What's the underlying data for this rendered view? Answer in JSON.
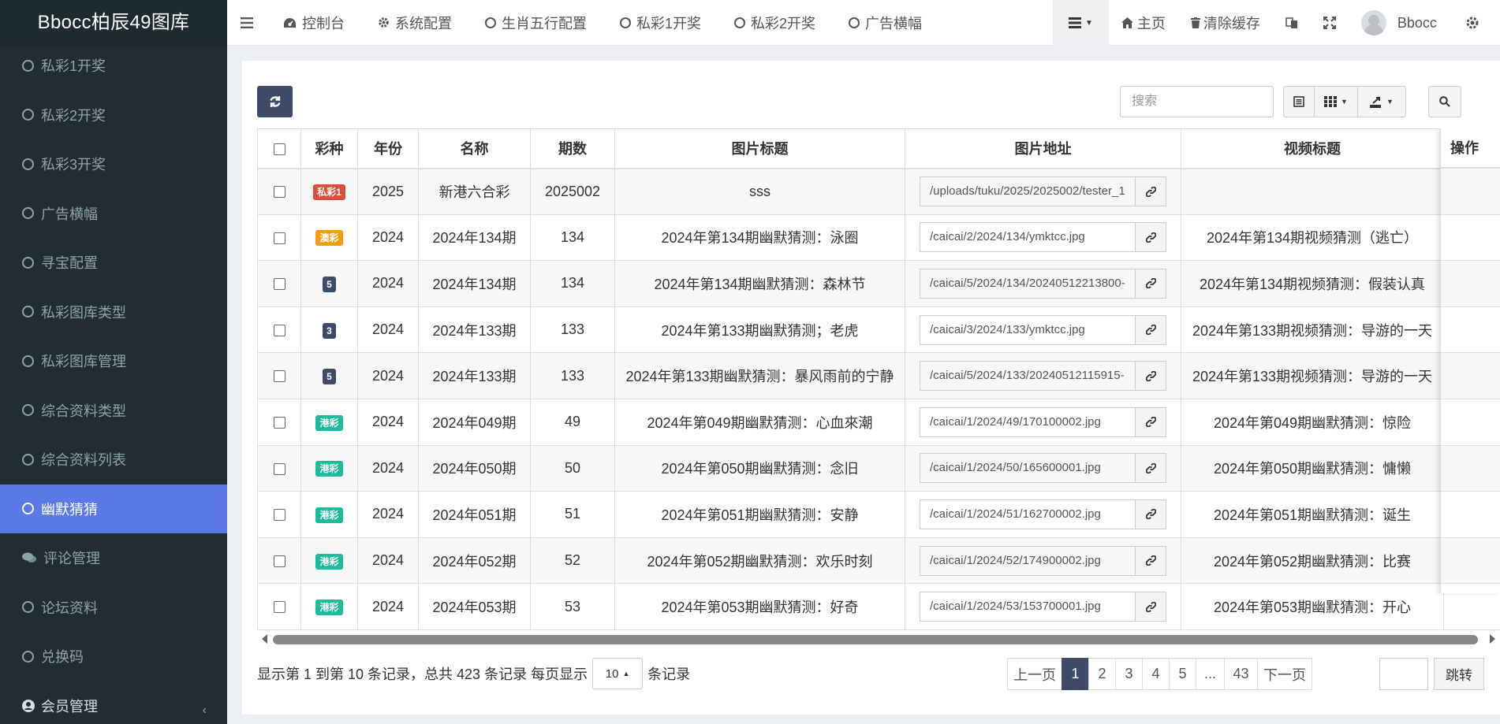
{
  "brand": "Bbocc柏辰49图库",
  "sidebar": {
    "items": [
      {
        "label": "私彩1开奖",
        "icon": "circle-icon",
        "active": false
      },
      {
        "label": "私彩2开奖",
        "icon": "circle-icon",
        "active": false
      },
      {
        "label": "私彩3开奖",
        "icon": "circle-icon",
        "active": false
      },
      {
        "label": "广告横幅",
        "icon": "circle-icon",
        "active": false
      },
      {
        "label": "寻宝配置",
        "icon": "circle-icon",
        "active": false
      },
      {
        "label": "私彩图库类型",
        "icon": "circle-icon",
        "active": false
      },
      {
        "label": "私彩图库管理",
        "icon": "circle-icon",
        "active": false
      },
      {
        "label": "综合资料类型",
        "icon": "circle-icon",
        "active": false
      },
      {
        "label": "综合资料列表",
        "icon": "circle-icon",
        "active": false
      },
      {
        "label": "幽默猜猜",
        "icon": "circle-icon",
        "active": true
      },
      {
        "label": "评论管理",
        "icon": "comments-icon",
        "active": false
      },
      {
        "label": "论坛资料",
        "icon": "circle-icon",
        "active": false
      },
      {
        "label": "兑换码",
        "icon": "circle-icon",
        "active": false
      }
    ],
    "member": {
      "label": "会员管理",
      "icon": "user-circle-icon"
    }
  },
  "topnav": {
    "items": [
      {
        "label": "控制台",
        "icon": "dashboard-icon"
      },
      {
        "label": "系统配置",
        "icon": "gear-icon"
      },
      {
        "label": "生肖五行配置",
        "icon": "circle-icon"
      },
      {
        "label": "私彩1开奖",
        "icon": "circle-icon"
      },
      {
        "label": "私彩2开奖",
        "icon": "circle-icon"
      },
      {
        "label": "广告横幅",
        "icon": "circle-icon"
      }
    ],
    "home": "主页",
    "clear_cache": "清除缓存",
    "user": "Bbocc"
  },
  "toolbar": {
    "search_placeholder": "搜索"
  },
  "table": {
    "columns": [
      "彩种",
      "年份",
      "名称",
      "期数",
      "图片标题",
      "图片地址",
      "视频标题",
      "操作"
    ],
    "rows": [
      {
        "badge": "私彩1",
        "badge_color": "#dd4b39",
        "year": "2025",
        "name": "新港六合彩",
        "issue": "2025002",
        "img_title": "sss",
        "img_url": "/uploads/tuku/2025/2025002/tester_1",
        "video_title": ""
      },
      {
        "badge": "澳彩",
        "badge_color": "#f39c12",
        "year": "2024",
        "name": "2024年134期",
        "issue": "134",
        "img_title": "2024年第134期幽默猜测：泳圈",
        "img_url": "/caicai/2/2024/134/ymktcc.jpg",
        "video_title": "2024年第134期视频猜测（逃亡）"
      },
      {
        "badge": "5",
        "badge_color": "#3d4a68",
        "year": "2024",
        "name": "2024年134期",
        "issue": "134",
        "img_title": "2024年第134期幽默猜测：森林节",
        "img_url": "/caicai/5/2024/134/20240512213800-",
        "video_title": "2024年第134期视频猜测：假装认真"
      },
      {
        "badge": "3",
        "badge_color": "#3d4a68",
        "year": "2024",
        "name": "2024年133期",
        "issue": "133",
        "img_title": "2024年第133期幽默猜测；老虎",
        "img_url": "/caicai/3/2024/133/ymktcc.jpg",
        "video_title": "2024年第133期视频猜测：导游的一天"
      },
      {
        "badge": "5",
        "badge_color": "#3d4a68",
        "year": "2024",
        "name": "2024年133期",
        "issue": "133",
        "img_title": "2024年第133期幽默猜测：暴风雨前的宁静",
        "img_url": "/caicai/5/2024/133/20240512115915-",
        "video_title": "2024年第133期视频猜测：导游的一天"
      },
      {
        "badge": "港彩",
        "badge_color": "#1abc9c",
        "year": "2024",
        "name": "2024年049期",
        "issue": "49",
        "img_title": "2024年第049期幽默猜测：心血來潮",
        "img_url": "/caicai/1/2024/49/170100002.jpg",
        "video_title": "2024年第049期幽默猜测：惊险"
      },
      {
        "badge": "港彩",
        "badge_color": "#1abc9c",
        "year": "2024",
        "name": "2024年050期",
        "issue": "50",
        "img_title": "2024年第050期幽默猜测：念旧",
        "img_url": "/caicai/1/2024/50/165600001.jpg",
        "video_title": "2024年第050期幽默猜测：慵懒"
      },
      {
        "badge": "港彩",
        "badge_color": "#1abc9c",
        "year": "2024",
        "name": "2024年051期",
        "issue": "51",
        "img_title": "2024年第051期幽默猜测：安静",
        "img_url": "/caicai/1/2024/51/162700002.jpg",
        "video_title": "2024年第051期幽默猜测：诞生"
      },
      {
        "badge": "港彩",
        "badge_color": "#1abc9c",
        "year": "2024",
        "name": "2024年052期",
        "issue": "52",
        "img_title": "2024年第052期幽默猜测：欢乐时刻",
        "img_url": "/caicai/1/2024/52/174900002.jpg",
        "video_title": "2024年第052期幽默猜测：比赛"
      },
      {
        "badge": "港彩",
        "badge_color": "#1abc9c",
        "year": "2024",
        "name": "2024年053期",
        "issue": "53",
        "img_title": "2024年第053期幽默猜测：好奇",
        "img_url": "/caicai/1/2024/53/153700001.jpg",
        "video_title": "2024年第053期幽默猜测：开心"
      }
    ]
  },
  "footer": {
    "info": "显示第 1 到第 10 条记录，总共 423 条记录 每页显示",
    "page_size": "10",
    "suffix": "条记录"
  },
  "pagination": {
    "prev": "上一页",
    "pages": [
      "1",
      "2",
      "3",
      "4",
      "5",
      "...",
      "43"
    ],
    "current": "1",
    "next": "下一页",
    "jump": "跳转"
  }
}
